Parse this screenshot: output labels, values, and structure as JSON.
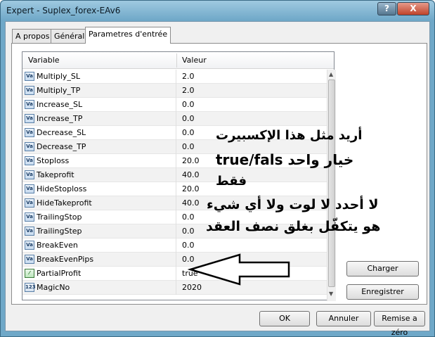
{
  "window": {
    "title": "Expert - Suplex_forex-EAv6",
    "help_label": "?",
    "close_label": "X"
  },
  "tabs": [
    {
      "label": "A propos",
      "active": false
    },
    {
      "label": "Général",
      "active": false
    },
    {
      "label": "Parametres d'entrée",
      "active": true
    }
  ],
  "grid": {
    "col_variable": "Variable",
    "col_value": "Valeur",
    "rows": [
      {
        "icon": "ab-icon",
        "icon_text": "Va",
        "name": "Multiply_SL",
        "value": "2.0"
      },
      {
        "icon": "ab-icon",
        "icon_text": "Va",
        "name": "Multiply_TP",
        "value": "2.0"
      },
      {
        "icon": "ab-icon",
        "icon_text": "Va",
        "name": "Increase_SL",
        "value": "0.0"
      },
      {
        "icon": "ab-icon",
        "icon_text": "Va",
        "name": "Increase_TP",
        "value": "0.0"
      },
      {
        "icon": "ab-icon",
        "icon_text": "Va",
        "name": "Decrease_SL",
        "value": "0.0"
      },
      {
        "icon": "ab-icon",
        "icon_text": "Va",
        "name": "Decrease_TP",
        "value": "0.0"
      },
      {
        "icon": "ab-icon",
        "icon_text": "Va",
        "name": "Stoploss",
        "value": "20.0"
      },
      {
        "icon": "ab-icon",
        "icon_text": "Va",
        "name": "Takeprofit",
        "value": "40.0"
      },
      {
        "icon": "ab-icon",
        "icon_text": "Va",
        "name": "HideStoploss",
        "value": "20.0"
      },
      {
        "icon": "ab-icon",
        "icon_text": "Va",
        "name": "HideTakeprofit",
        "value": "40.0"
      },
      {
        "icon": "ab-icon",
        "icon_text": "Va",
        "name": "TrailingStop",
        "value": "0.0"
      },
      {
        "icon": "ab-icon",
        "icon_text": "Va",
        "name": "TrailingStep",
        "value": "0.0"
      },
      {
        "icon": "ab-icon",
        "icon_text": "Va",
        "name": "BreakEven",
        "value": "0.0"
      },
      {
        "icon": "ab-icon",
        "icon_text": "Va",
        "name": "BreakEvenPips",
        "value": "0.0"
      },
      {
        "icon": "bool-icon",
        "icon_text": "⁄",
        "name": "PartialProfit",
        "value": "true"
      },
      {
        "icon": "int-icon",
        "icon_text": "123",
        "name": "MagicNo",
        "value": "2020"
      }
    ]
  },
  "side_buttons": {
    "charger": "Charger",
    "enregistrer": "Enregistrer"
  },
  "bottom_buttons": {
    "ok": "OK",
    "annuler": "Annuler",
    "reset": "Remise a zéro"
  },
  "annotation": {
    "line1": "أريد مثل هذا الإكسبيرت",
    "line2": "خيار واحد true/fals",
    "line3": "فقط",
    "line4": "لا أحدد لا لوت ولا أي شيء",
    "line5": "هو يتكفّل بغلق نصف العقد"
  }
}
